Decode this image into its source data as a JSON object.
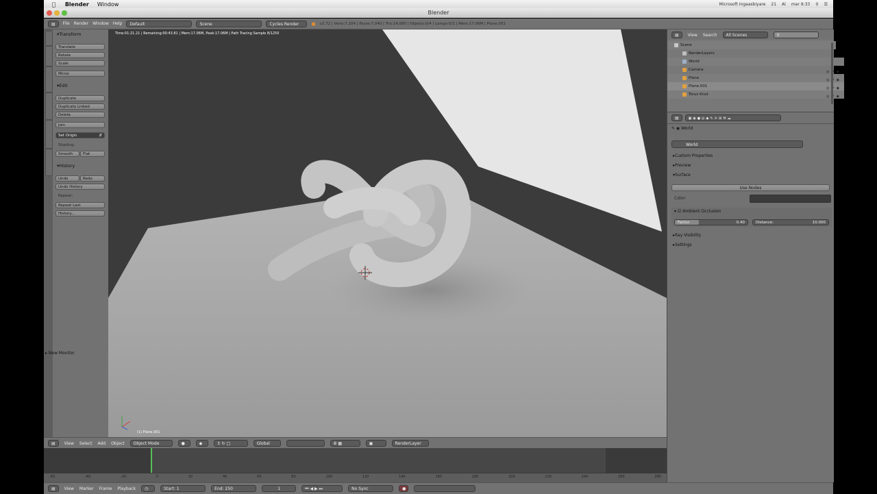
{
  "menubar": {
    "app": "Blender",
    "items": [
      "Window"
    ],
    "status": [
      "Microsoft Ingaasbiyare",
      "21",
      "Al",
      "mar 9:33"
    ]
  },
  "window": {
    "title": "Blender"
  },
  "info": {
    "menus": [
      "File",
      "Render",
      "Window",
      "Help"
    ],
    "screen": "Default",
    "scene": "Scene",
    "engine": "Cycles Render",
    "stats": "v2.72 | Verts:7,204 | Faces:7,040 | Tris:14,080 | Objects:0/4 | Lamps:0/1 | Mem:17.06M | Plane.001"
  },
  "toolshelf": {
    "transform": {
      "title": "Transform",
      "buttons": [
        "Translate",
        "Rotate",
        "Scale",
        "Mirror"
      ]
    },
    "edit": {
      "title": "Edit",
      "buttons": [
        "Duplicate",
        "Duplicate Linked",
        "Delete",
        "Join"
      ],
      "origin": "Set Origin"
    },
    "shading": {
      "label": "Shading:",
      "smooth": "Smooth",
      "flat": "Flat"
    },
    "history": {
      "title": "History",
      "undo": "Undo",
      "redo": "Redo",
      "undo_history": "Undo History",
      "repeat_label": "Repeat:",
      "repeat_last": "Repeat Last",
      "history": "History..."
    },
    "new_monitor": "New Monitor"
  },
  "viewport": {
    "render_info": "Time:01:21.21 | Remaining:00:43.81 | Mem:17.06M, Peak:17.06M | Path Tracing Sample 8/1250",
    "object_label": "(1) Plane.001"
  },
  "header3d": {
    "menus": [
      "View",
      "Select",
      "Add",
      "Object"
    ],
    "mode": "Object Mode",
    "orientation": "Global",
    "render_layer": "RenderLayer"
  },
  "timeline": {
    "ticks": [
      "-50",
      "-40",
      "-20",
      "0",
      "20",
      "40",
      "60",
      "80",
      "100",
      "120",
      "140",
      "160",
      "180",
      "200",
      "220",
      "240",
      "260",
      "280"
    ],
    "menus": [
      "View",
      "Marker",
      "Frame",
      "Playback"
    ],
    "start": "Start:",
    "start_val": "1",
    "end": "End:",
    "end_val": "250",
    "current": "1",
    "sync": "No Sync"
  },
  "outliner": {
    "menus": [
      "View",
      "Search"
    ],
    "filter": "All Scenes",
    "rows": [
      {
        "label": "Scene",
        "color": "#c8c8c8"
      },
      {
        "label": "RenderLayers",
        "color": "#bfbfbf"
      },
      {
        "label": "World",
        "color": "#9fb0c8"
      },
      {
        "label": "Camera",
        "color": "#e0a040"
      },
      {
        "label": "Plane",
        "color": "#e0a040"
      },
      {
        "label": "Plane.001",
        "color": "#e0a040"
      },
      {
        "label": "Torus Knot",
        "color": "#e0a040"
      }
    ]
  },
  "properties": {
    "breadcrumb": "World",
    "world_name": "World",
    "sections": [
      "Custom Properties",
      "Preview",
      "Surface"
    ],
    "use_nodes": "Use Nodes",
    "color_label": "Color:",
    "ao": "Ambient Occlusion",
    "factor": "Factor:",
    "factor_val": "0.40",
    "distance": "Distance:",
    "distance_val": "10.000",
    "more": [
      "Ray Visibility",
      "Settings"
    ]
  },
  "colors": {
    "background_wall": "#3b3b3b",
    "bright_plane": "#e6e6e6",
    "floor": "#a0a0a0",
    "ui_panel": "#727272"
  }
}
